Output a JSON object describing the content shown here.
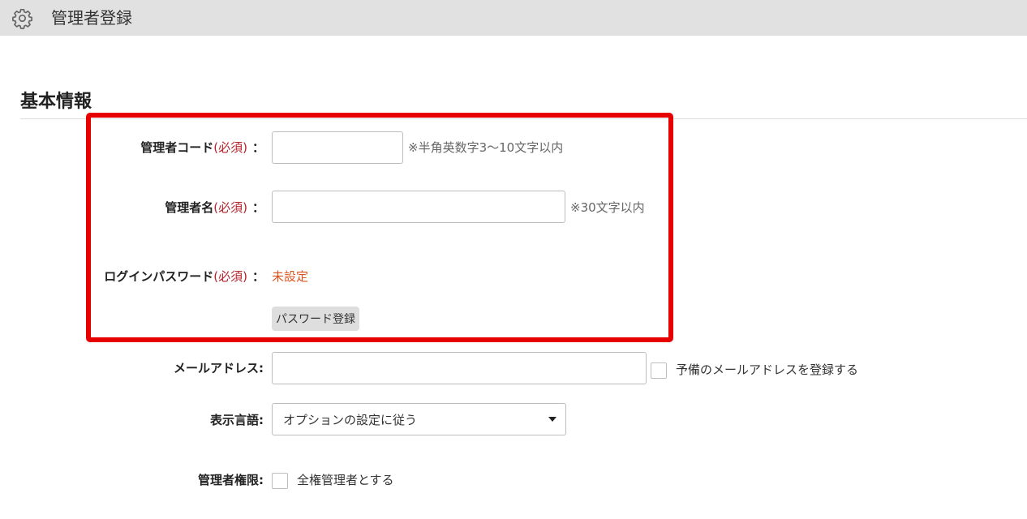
{
  "header": {
    "icon": "gear-icon",
    "title": "管理者登録"
  },
  "section": {
    "title": "基本情報"
  },
  "colors": {
    "header_bg": "#e1e1e1",
    "highlight_border": "#e60000",
    "required_text": "#b5222a",
    "unset_text": "#d9531e"
  },
  "form": {
    "admin_code": {
      "label": "管理者コード",
      "required": "(必須)",
      "colon": "：",
      "value": "",
      "hint": "※半角英数字3～10文字以内"
    },
    "admin_name": {
      "label": "管理者名",
      "required": "(必須)",
      "colon": "：",
      "value": "",
      "hint": "※30文字以内"
    },
    "login_password": {
      "label": "ログインパスワード",
      "required": "(必須)",
      "colon": "：",
      "status": "未設定",
      "button_label": "パスワード登録"
    },
    "email": {
      "label": "メールアドレス:",
      "value": "",
      "backup_checkbox_label": "予備のメールアドレスを登録する",
      "backup_checked": false
    },
    "display_language": {
      "label": "表示言語:",
      "selected": "オプションの設定に従う"
    },
    "admin_privilege": {
      "label": "管理者権限:",
      "checkbox_label": "全権管理者とする",
      "checked": false
    }
  }
}
